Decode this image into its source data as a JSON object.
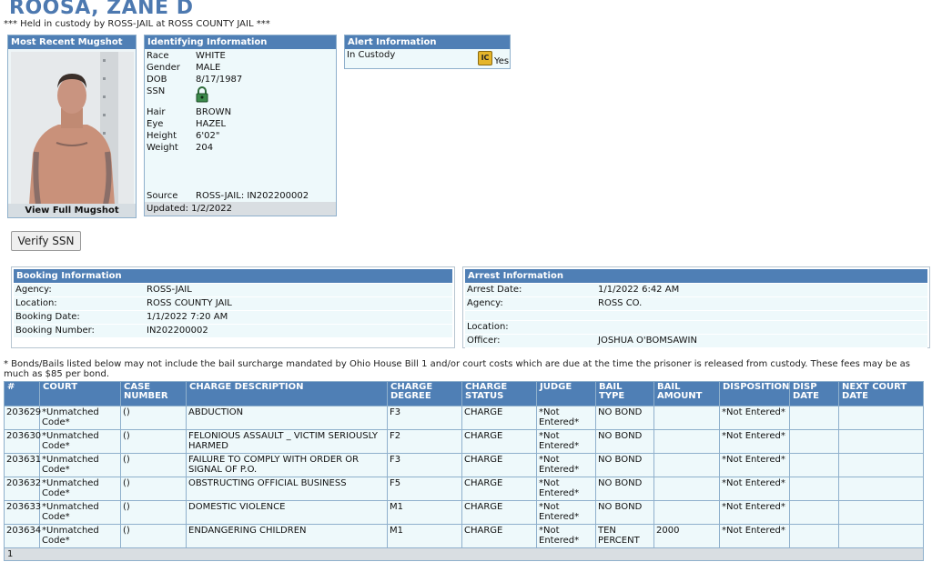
{
  "header": {
    "name": "ROOSA, ZANE D",
    "custody_line": "*** Held in custody by ROSS-JAIL at ROSS COUNTY JAIL ***"
  },
  "mugshot": {
    "title": "Most Recent Mugshot",
    "link": "View Full Mugshot"
  },
  "identifying": {
    "title": "Identifying Information",
    "rows": [
      {
        "label": "Race",
        "value": "WHITE"
      },
      {
        "label": "Gender",
        "value": "MALE"
      },
      {
        "label": "DOB",
        "value": "8/17/1987"
      },
      {
        "label": "SSN",
        "value": ""
      },
      {
        "label": "Hair",
        "value": "BROWN"
      },
      {
        "label": "Eye",
        "value": "HAZEL"
      },
      {
        "label": "Height",
        "value": "6'02\""
      },
      {
        "label": "Weight",
        "value": "204"
      }
    ],
    "source_label": "Source",
    "source_value": "ROSS-JAIL: IN202200002",
    "updated": "Updated: 1/2/2022",
    "ssn_icon": "lock-icon"
  },
  "alert": {
    "title": "Alert Information",
    "label": "In Custody",
    "badge": "IC",
    "value": "Yes"
  },
  "verify_button": "Verify SSN",
  "booking": {
    "title": "Booking Information",
    "rows": [
      {
        "label": "Agency:",
        "value": "ROSS-JAIL"
      },
      {
        "label": "Location:",
        "value": "ROSS COUNTY JAIL"
      },
      {
        "label": "Booking Date:",
        "value": "1/1/2022 7:20 AM"
      },
      {
        "label": "Booking Number:",
        "value": "IN202200002"
      }
    ]
  },
  "arrest": {
    "title": "Arrest Information",
    "rows": [
      {
        "label": "Arrest Date:",
        "value": "1/1/2022 6:42 AM"
      },
      {
        "label": "Agency:",
        "value": "ROSS CO."
      },
      {
        "label": "Location:",
        "value": ""
      },
      {
        "label": "Officer:",
        "value": "JOSHUA O'BOMSAWIN"
      }
    ]
  },
  "note": "* Bonds/Bails listed below may not include the bail surcharge mandated by Ohio House Bill 1 and/or court costs which are due at the time the prisoner is released from custody. These fees may be as much as $85 per bond.",
  "charges": {
    "headers": [
      "#",
      "COURT",
      "CASE NUMBER",
      "CHARGE DESCRIPTION",
      "CHARGE DEGREE",
      "CHARGE STATUS",
      "JUDGE",
      "BAIL TYPE",
      "BAIL AMOUNT",
      "DISPOSITION",
      "DISP DATE",
      "NEXT COURT DATE"
    ],
    "rows": [
      [
        "203629",
        "*Unmatched Code*",
        "()",
        "ABDUCTION",
        "F3",
        "CHARGE",
        "*Not Entered*",
        "NO BOND",
        "",
        "*Not Entered*",
        "",
        ""
      ],
      [
        "203630",
        "*Unmatched Code*",
        "()",
        "FELONIOUS ASSAULT _ VICTIM SERIOUSLY HARMED",
        "F2",
        "CHARGE",
        "*Not Entered*",
        "NO BOND",
        "",
        "*Not Entered*",
        "",
        ""
      ],
      [
        "203631",
        "*Unmatched Code*",
        "()",
        "FAILURE TO COMPLY WITH ORDER OR SIGNAL OF P.O.",
        "F3",
        "CHARGE",
        "*Not Entered*",
        "NO BOND",
        "",
        "*Not Entered*",
        "",
        ""
      ],
      [
        "203632",
        "*Unmatched Code*",
        "()",
        "OBSTRUCTING OFFICIAL BUSINESS",
        "F5",
        "CHARGE",
        "*Not Entered*",
        "NO BOND",
        "",
        "*Not Entered*",
        "",
        ""
      ],
      [
        "203633",
        "*Unmatched Code*",
        "()",
        "DOMESTIC VIOLENCE",
        "M1",
        "CHARGE",
        "*Not Entered*",
        "NO BOND",
        "",
        "*Not Entered*",
        "",
        ""
      ],
      [
        "203634",
        "*Unmatched Code*",
        "()",
        "ENDANGERING CHILDREN",
        "M1",
        "CHARGE",
        "*Not Entered*",
        "TEN PERCENT",
        "2000",
        "*Not Entered*",
        "",
        ""
      ]
    ],
    "footer": "1"
  }
}
